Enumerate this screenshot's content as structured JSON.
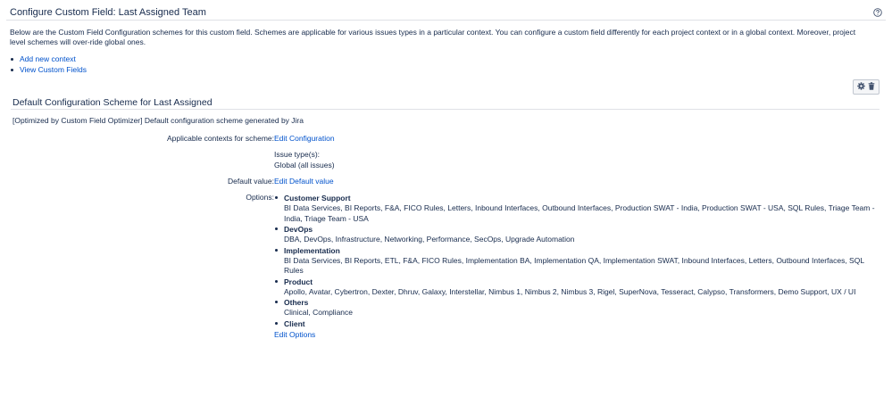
{
  "page": {
    "title": "Configure Custom Field: Last Assigned Team",
    "help_icon": "question-circle-icon",
    "intro": "Below are the Custom Field Configuration schemes for this custom field. Schemes are applicable for various issues types in a particular context. You can configure a custom field differently for each project context or in a global context. Moreover, project level schemes will over-ride global ones.",
    "links": [
      "Add new context",
      "View Custom Fields"
    ]
  },
  "scheme": {
    "title": "Default Configuration Scheme for Last Assigned",
    "description": "[Optimized by Custom Field Optimizer] Default configuration scheme generated by Jira",
    "actions": [
      "gear-icon",
      "trash-icon"
    ],
    "contexts_label": "Applicable contexts for scheme:",
    "contexts_link": "Edit Configuration",
    "issue_types_label": "Issue type(s):",
    "issue_types_value": "Global (all issues)",
    "default_label": "Default value:",
    "default_link": "Edit Default value",
    "options_label": "Options:",
    "options": [
      {
        "name": "Customer Support",
        "values": "BI Data Services, BI Reports, F&A, FICO Rules, Letters, Inbound Interfaces, Outbound Interfaces, Production SWAT - India, Production SWAT - USA, SQL Rules, Triage Team - India, Triage Team - USA"
      },
      {
        "name": "DevOps",
        "values": "DBA, DevOps, Infrastructure, Networking, Performance, SecOps, Upgrade Automation"
      },
      {
        "name": "Implementation",
        "values": "BI Data Services, BI Reports, ETL, F&A, FICO Rules, Implementation BA, Implementation QA, Implementation SWAT, Inbound Interfaces, Letters, Outbound Interfaces, SQL Rules"
      },
      {
        "name": "Product",
        "values": "Apollo, Avatar, Cybertron, Dexter, Dhruv, Galaxy, Interstellar, Nimbus 1, Nimbus 2, Nimbus 3, Rigel, SuperNova, Tesseract, Calypso, Transformers, Demo Support, UX / UI"
      },
      {
        "name": "Others",
        "values": "Clinical, Compliance"
      },
      {
        "name": "Client",
        "values": ""
      }
    ],
    "edit_options_link": "Edit Options"
  }
}
